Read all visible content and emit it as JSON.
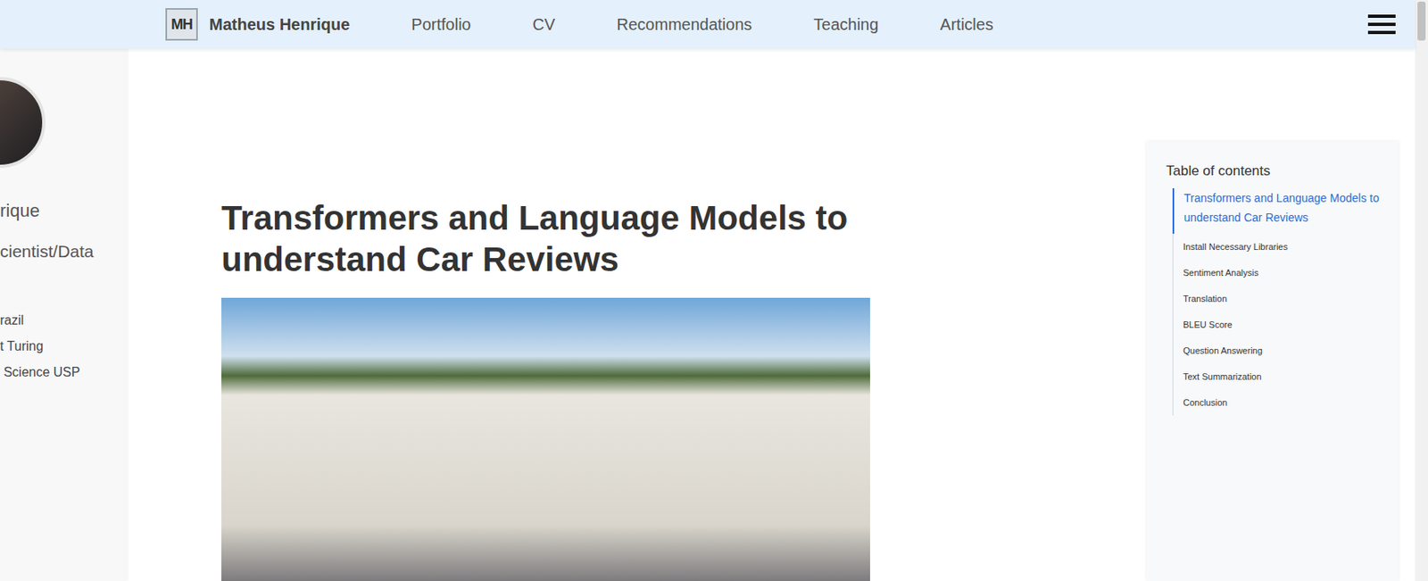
{
  "navbar": {
    "logo": "MH",
    "name": "Matheus Henrique",
    "items": [
      {
        "label": "Portfolio",
        "selected": false
      },
      {
        "label": "CV",
        "selected": false
      },
      {
        "label": "Recommendations",
        "selected": false
      },
      {
        "label": "Teaching",
        "selected": false
      },
      {
        "label": "Articles",
        "selected": false
      }
    ]
  },
  "sidebar": {
    "name": "rique",
    "role": "cientist/Data",
    "details": [
      "razil",
      "t Turing",
      " Science USP"
    ]
  },
  "article": {
    "title": "Transformers and Language Models to understand Car Reviews"
  },
  "toc": {
    "heading": "Table of contents",
    "items": [
      {
        "label": "Transformers and Language Models to understand Car Reviews",
        "selected": true
      },
      {
        "label": "Install Necessary Libraries",
        "selected": false
      },
      {
        "label": "Sentiment Analysis",
        "selected": false
      },
      {
        "label": "Translation",
        "selected": false
      },
      {
        "label": "BLEU Score",
        "selected": false
      },
      {
        "label": "Question Answering",
        "selected": false
      },
      {
        "label": "Text Summarization",
        "selected": false
      },
      {
        "label": "Conclusion",
        "selected": false
      }
    ]
  }
}
